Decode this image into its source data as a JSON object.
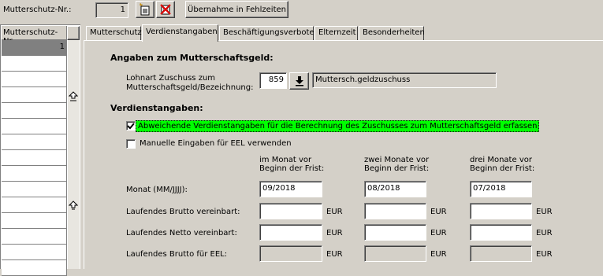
{
  "toolbar": {
    "nr_label": "Mutterschutz-Nr.:",
    "nr_value": "1",
    "transfer_button": "Übernahme in Fehlzeiten",
    "new_icon": "new-record-icon",
    "delete_icon": "delete-record-icon"
  },
  "grid": {
    "header": "Mutterschutz-Nr.",
    "rows": [
      "1",
      "",
      "",
      "",
      "",
      "",
      "",
      "",
      "",
      "",
      "",
      "",
      "",
      ""
    ]
  },
  "tabs": [
    {
      "label": "Mutterschutz",
      "active": false
    },
    {
      "label": "Verdienstangaben",
      "active": true
    },
    {
      "label": "Beschäftigungsverbote",
      "active": false
    },
    {
      "label": "Elternzeit",
      "active": false
    },
    {
      "label": "Besonderheiten",
      "active": false
    }
  ],
  "section1": {
    "title": "Angaben zum Mutterschaftsgeld:",
    "lohnart_label_1": "Lohnart Zuschuss zum",
    "lohnart_label_2": "Mutterschaftsgeld/Bezeichnung:",
    "lohnart_code": "859",
    "lohnart_name": "Muttersch.geldzuschuss"
  },
  "section2": {
    "title": "Verdienstangaben:",
    "check1_label": "Abweichende Verdienstangaben für die Berechnung des Zuschusses zum Mutterschaftsgeld erfassen",
    "check1_checked": true,
    "check2_label": "Manuelle Eingaben für EEL verwenden",
    "check2_checked": false
  },
  "columns": [
    {
      "header_1": "im Monat vor",
      "header_2": "Beginn der Frist:",
      "month": "09/2018"
    },
    {
      "header_1": "zwei Monate vor",
      "header_2": "Beginn der Frist:",
      "month": "08/2018"
    },
    {
      "header_1": "drei Monate vor",
      "header_2": "Beginn der Frist:",
      "month": "07/2018"
    }
  ],
  "rows": {
    "monat": "Monat (MM/JJJJ):",
    "brutto": "Laufendes Brutto vereinbart:",
    "netto": "Laufendes Netto vereinbart:",
    "brutto_eel": "Laufendes Brutto für EEL:"
  },
  "currency": "EUR",
  "colors": {
    "highlight": "#00ff00",
    "grid_selected": "#808080"
  }
}
